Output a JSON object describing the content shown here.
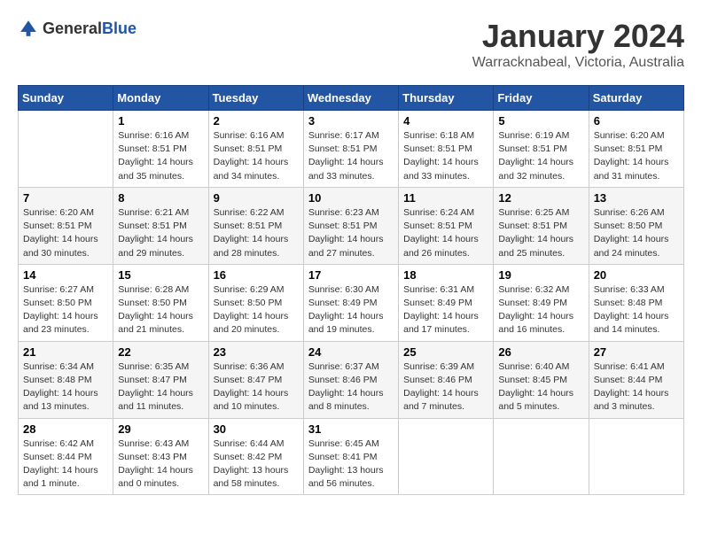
{
  "header": {
    "logo_general": "General",
    "logo_blue": "Blue",
    "month_title": "January 2024",
    "subtitle": "Warracknabeal, Victoria, Australia"
  },
  "days_of_week": [
    "Sunday",
    "Monday",
    "Tuesday",
    "Wednesday",
    "Thursday",
    "Friday",
    "Saturday"
  ],
  "weeks": [
    [
      {
        "date": "",
        "info": ""
      },
      {
        "date": "1",
        "info": "Sunrise: 6:16 AM\nSunset: 8:51 PM\nDaylight: 14 hours\nand 35 minutes."
      },
      {
        "date": "2",
        "info": "Sunrise: 6:16 AM\nSunset: 8:51 PM\nDaylight: 14 hours\nand 34 minutes."
      },
      {
        "date": "3",
        "info": "Sunrise: 6:17 AM\nSunset: 8:51 PM\nDaylight: 14 hours\nand 33 minutes."
      },
      {
        "date": "4",
        "info": "Sunrise: 6:18 AM\nSunset: 8:51 PM\nDaylight: 14 hours\nand 33 minutes."
      },
      {
        "date": "5",
        "info": "Sunrise: 6:19 AM\nSunset: 8:51 PM\nDaylight: 14 hours\nand 32 minutes."
      },
      {
        "date": "6",
        "info": "Sunrise: 6:20 AM\nSunset: 8:51 PM\nDaylight: 14 hours\nand 31 minutes."
      }
    ],
    [
      {
        "date": "7",
        "info": "Sunrise: 6:20 AM\nSunset: 8:51 PM\nDaylight: 14 hours\nand 30 minutes."
      },
      {
        "date": "8",
        "info": "Sunrise: 6:21 AM\nSunset: 8:51 PM\nDaylight: 14 hours\nand 29 minutes."
      },
      {
        "date": "9",
        "info": "Sunrise: 6:22 AM\nSunset: 8:51 PM\nDaylight: 14 hours\nand 28 minutes."
      },
      {
        "date": "10",
        "info": "Sunrise: 6:23 AM\nSunset: 8:51 PM\nDaylight: 14 hours\nand 27 minutes."
      },
      {
        "date": "11",
        "info": "Sunrise: 6:24 AM\nSunset: 8:51 PM\nDaylight: 14 hours\nand 26 minutes."
      },
      {
        "date": "12",
        "info": "Sunrise: 6:25 AM\nSunset: 8:51 PM\nDaylight: 14 hours\nand 25 minutes."
      },
      {
        "date": "13",
        "info": "Sunrise: 6:26 AM\nSunset: 8:50 PM\nDaylight: 14 hours\nand 24 minutes."
      }
    ],
    [
      {
        "date": "14",
        "info": "Sunrise: 6:27 AM\nSunset: 8:50 PM\nDaylight: 14 hours\nand 23 minutes."
      },
      {
        "date": "15",
        "info": "Sunrise: 6:28 AM\nSunset: 8:50 PM\nDaylight: 14 hours\nand 21 minutes."
      },
      {
        "date": "16",
        "info": "Sunrise: 6:29 AM\nSunset: 8:50 PM\nDaylight: 14 hours\nand 20 minutes."
      },
      {
        "date": "17",
        "info": "Sunrise: 6:30 AM\nSunset: 8:49 PM\nDaylight: 14 hours\nand 19 minutes."
      },
      {
        "date": "18",
        "info": "Sunrise: 6:31 AM\nSunset: 8:49 PM\nDaylight: 14 hours\nand 17 minutes."
      },
      {
        "date": "19",
        "info": "Sunrise: 6:32 AM\nSunset: 8:49 PM\nDaylight: 14 hours\nand 16 minutes."
      },
      {
        "date": "20",
        "info": "Sunrise: 6:33 AM\nSunset: 8:48 PM\nDaylight: 14 hours\nand 14 minutes."
      }
    ],
    [
      {
        "date": "21",
        "info": "Sunrise: 6:34 AM\nSunset: 8:48 PM\nDaylight: 14 hours\nand 13 minutes."
      },
      {
        "date": "22",
        "info": "Sunrise: 6:35 AM\nSunset: 8:47 PM\nDaylight: 14 hours\nand 11 minutes."
      },
      {
        "date": "23",
        "info": "Sunrise: 6:36 AM\nSunset: 8:47 PM\nDaylight: 14 hours\nand 10 minutes."
      },
      {
        "date": "24",
        "info": "Sunrise: 6:37 AM\nSunset: 8:46 PM\nDaylight: 14 hours\nand 8 minutes."
      },
      {
        "date": "25",
        "info": "Sunrise: 6:39 AM\nSunset: 8:46 PM\nDaylight: 14 hours\nand 7 minutes."
      },
      {
        "date": "26",
        "info": "Sunrise: 6:40 AM\nSunset: 8:45 PM\nDaylight: 14 hours\nand 5 minutes."
      },
      {
        "date": "27",
        "info": "Sunrise: 6:41 AM\nSunset: 8:44 PM\nDaylight: 14 hours\nand 3 minutes."
      }
    ],
    [
      {
        "date": "28",
        "info": "Sunrise: 6:42 AM\nSunset: 8:44 PM\nDaylight: 14 hours\nand 1 minute."
      },
      {
        "date": "29",
        "info": "Sunrise: 6:43 AM\nSunset: 8:43 PM\nDaylight: 14 hours\nand 0 minutes."
      },
      {
        "date": "30",
        "info": "Sunrise: 6:44 AM\nSunset: 8:42 PM\nDaylight: 13 hours\nand 58 minutes."
      },
      {
        "date": "31",
        "info": "Sunrise: 6:45 AM\nSunset: 8:41 PM\nDaylight: 13 hours\nand 56 minutes."
      },
      {
        "date": "",
        "info": ""
      },
      {
        "date": "",
        "info": ""
      },
      {
        "date": "",
        "info": ""
      }
    ]
  ]
}
